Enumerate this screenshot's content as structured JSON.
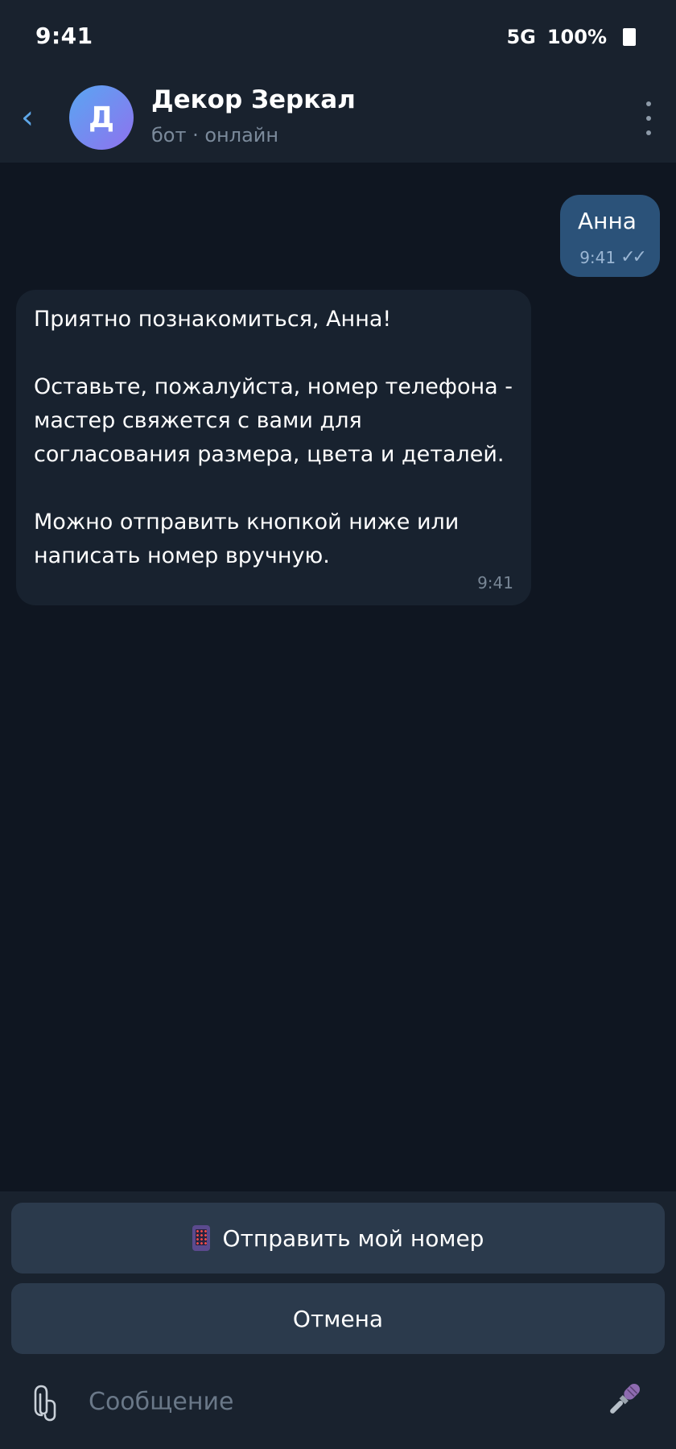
{
  "status_bar": {
    "time": "9:41",
    "network": "5G",
    "battery": "100%"
  },
  "header": {
    "back_icon": "‹",
    "avatar_letter": "Д",
    "title": "Декор Зеркал",
    "subtitle": "бот · онлайн"
  },
  "messages": {
    "outgoing": {
      "text": "Анна",
      "time": "9:41",
      "status_icon": "double-check-icon"
    },
    "incoming": {
      "text": "Приятно познакомиться, Анна!\n\nОставьте, пожалуйста, номер телефона - мастер свяжется с вами для согласования размера, цвета и деталей.\n\nМожно отправить кнопкой ниже или написать номер вручную.",
      "time": "9:41"
    }
  },
  "keyboard": {
    "send_phone_label": "Отправить мой номер",
    "cancel_label": "Отмена"
  },
  "input": {
    "placeholder": "Сообщение"
  },
  "colors": {
    "background": "#0f1621",
    "bar": "#19222e",
    "outgoing_bubble": "#2b5279",
    "incoming_bubble": "#18222f",
    "keyboard_button": "#2b3a4c",
    "accent": "#5ea7e8"
  }
}
